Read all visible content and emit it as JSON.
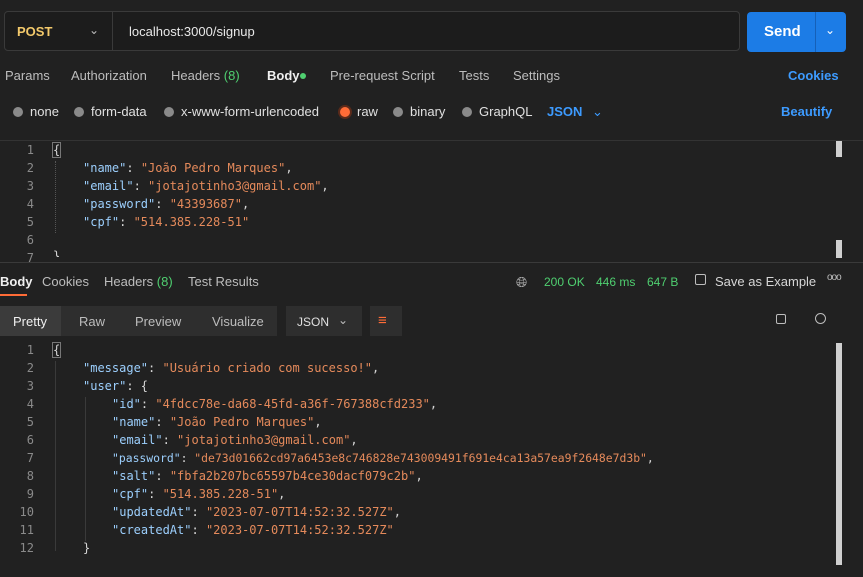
{
  "request": {
    "method": "POST",
    "url": "localhost:3000/signup",
    "send_label": "Send"
  },
  "req_tabs": [
    "Params",
    "Authorization",
    "Headers",
    "(8)",
    "Body",
    "Pre-request Script",
    "Tests",
    "Settings"
  ],
  "cookies_label": "Cookies",
  "body_types": [
    "none",
    "form-data",
    "x-www-form-urlencoded",
    "raw",
    "binary",
    "GraphQL"
  ],
  "body_format": "JSON",
  "beautify_label": "Beautify",
  "request_body": {
    "line_numbers": [
      "1",
      "2",
      "3",
      "4",
      "5",
      "6",
      "7"
    ],
    "open": "{",
    "fields": [
      {
        "key": "\"name\"",
        "value": "\"João Pedro Marques\"",
        "tail": ","
      },
      {
        "key": "\"email\"",
        "value": "\"jotajotinho3@gmail.com\"",
        "tail": ","
      },
      {
        "key": "\"password\"",
        "value": "\"43393687\"",
        "tail": ","
      },
      {
        "key": "\"cpf\"",
        "value": "\"514.385.228-51\"",
        "tail": ""
      }
    ],
    "close": "}"
  },
  "resp_tabs": [
    "Body",
    "Cookies",
    "Headers",
    "(8)",
    "Test Results"
  ],
  "status": {
    "code": "200 OK",
    "time": "446 ms",
    "size": "647 B"
  },
  "save_example_label": "Save as Example",
  "more_label": "ooo",
  "view_modes": [
    "Pretty",
    "Raw",
    "Preview",
    "Visualize"
  ],
  "response_format": "JSON",
  "response_body": {
    "line_numbers": [
      "1",
      "2",
      "3",
      "4",
      "5",
      "6",
      "7",
      "8",
      "9",
      "10",
      "11",
      "12"
    ],
    "open": "{",
    "message_key": "\"message\"",
    "message_value": "\"Usuário criado com sucesso!\"",
    "user_key": "\"user\"",
    "user_fields": [
      {
        "key": "\"id\"",
        "value": "\"4fdcc78e-da68-45fd-a36f-767388cfd233\"",
        "tail": ","
      },
      {
        "key": "\"name\"",
        "value": "\"João Pedro Marques\"",
        "tail": ","
      },
      {
        "key": "\"email\"",
        "value": "\"jotajotinho3@gmail.com\"",
        "tail": ","
      },
      {
        "key": "\"password\"",
        "value": "\"de73d01662cd97a6453e8c746828e743009491f691e4ca13a57ea9f2648e7d3b\"",
        "tail": ","
      },
      {
        "key": "\"salt\"",
        "value": "\"fbfa2b207bc65597b4ce30dacf079c2b\"",
        "tail": ","
      },
      {
        "key": "\"cpf\"",
        "value": "\"514.385.228-51\"",
        "tail": ","
      },
      {
        "key": "\"updatedAt\"",
        "value": "\"2023-07-07T14:52:32.527Z\"",
        "tail": ","
      },
      {
        "key": "\"createdAt\"",
        "value": "\"2023-07-07T14:52:32.527Z\"",
        "tail": ""
      }
    ],
    "close_inner": "}"
  },
  "colors": {
    "accent": "#ff6c37",
    "send": "#1c7ce6",
    "link": "#3d9bff",
    "ok": "#4fcf70",
    "json_key": "#9ccffd",
    "json_string": "#e58a5b"
  }
}
